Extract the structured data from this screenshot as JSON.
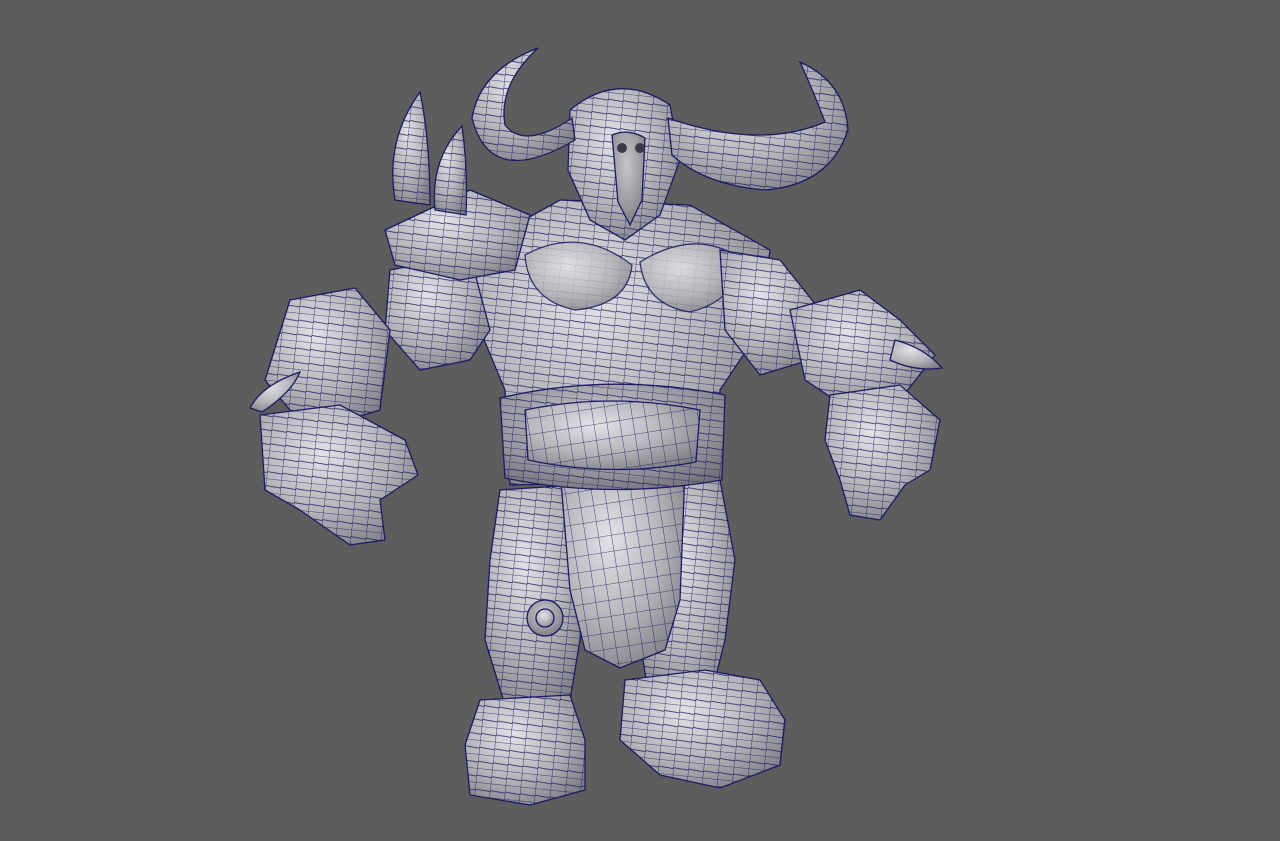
{
  "viewport": {
    "background_color": "#5d5d5d",
    "display_mode": "wireframe-on-shaded",
    "shading_color": "#b9b9bd",
    "wireframe_color": "#1d1a66"
  },
  "model": {
    "subject": "horned-brute-character",
    "view": "front-perspective"
  }
}
